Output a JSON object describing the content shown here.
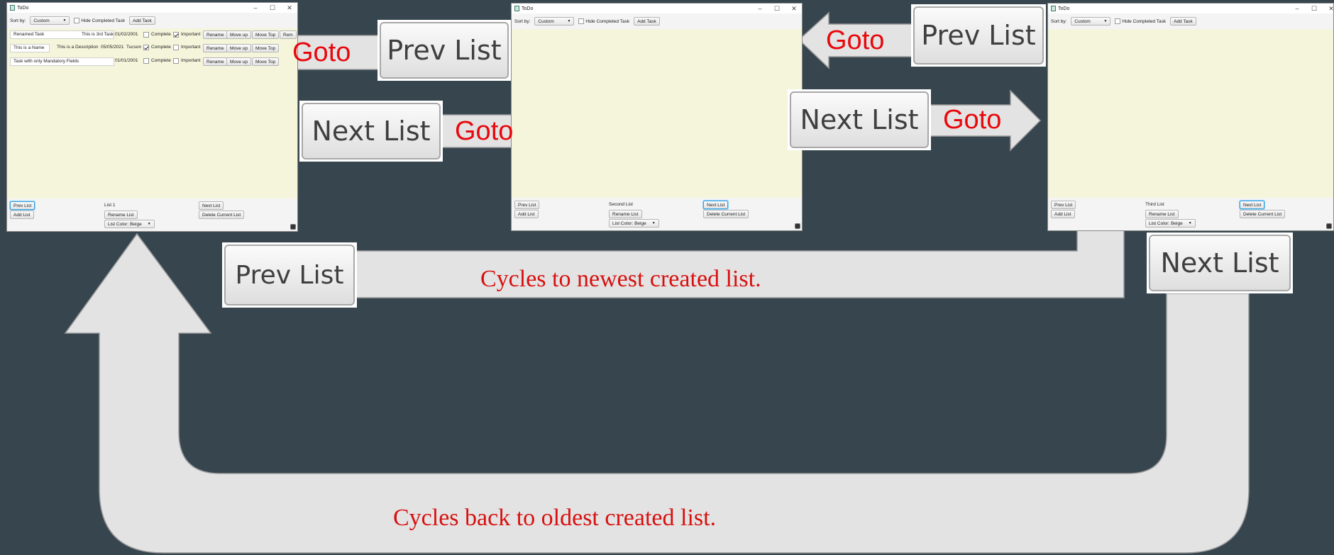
{
  "windows": [
    {
      "title": "ToDo",
      "toolbar": {
        "sort_label": "Sort by:",
        "sort_value": "Custom",
        "hide_label": "Hide Completed Task",
        "add_task": "Add Task"
      },
      "tasks": [
        {
          "name": "Renamed Task",
          "description": "This is 3rd Task",
          "date": "01/02/2001",
          "location": "",
          "complete": false,
          "important": true
        },
        {
          "name": "This is a Name",
          "description": "This is a Description",
          "date": "05/05/2021",
          "location": "Tucson",
          "complete": true,
          "important": false
        },
        {
          "name": "Task with only Mandatory Fields",
          "description": "",
          "date": "01/01/2001",
          "location": "",
          "complete": false,
          "important": false
        }
      ],
      "task_labels": {
        "complete": "Complete",
        "important": "Important",
        "rename": "Rename",
        "move_up": "Move up",
        "move_top": "Move Top",
        "remove": "Rem"
      },
      "bottom": {
        "prev_list": "Prev List",
        "add_list": "Add List",
        "list_name": "List 1",
        "rename_list": "Rename List",
        "list_color": "List Color: Beige",
        "next_list": "Next List",
        "delete_list": "Delete Current List"
      }
    },
    {
      "title": "ToDo",
      "toolbar": {
        "sort_label": "Sort by:",
        "sort_value": "Custom",
        "hide_label": "Hide Completed Task",
        "add_task": "Add Task"
      },
      "tasks": [],
      "bottom": {
        "prev_list": "Prev List",
        "add_list": "Add List",
        "list_name": "Second List",
        "rename_list": "Rename List",
        "list_color": "List Color: Beige",
        "next_list": "Next List",
        "delete_list": "Delete Current List"
      }
    },
    {
      "title": "ToDo",
      "toolbar": {
        "sort_label": "Sort by:",
        "sort_value": "Custom",
        "hide_label": "Hide Completed Task",
        "add_task": "Add Task"
      },
      "tasks": [],
      "bottom": {
        "prev_list": "Prev List",
        "add_list": "Add List",
        "list_name": "Third List",
        "rename_list": "Rename List",
        "list_color": "List Color: Beige",
        "next_list": "Next List",
        "delete_list": "Delete Current List"
      }
    }
  ],
  "callouts": {
    "prev_list": "Prev List",
    "next_list": "Next List",
    "goto": "Goto"
  },
  "captions": {
    "newest": "Cycles to newest created list.",
    "oldest": "Cycles back to oldest created list."
  },
  "colors": {
    "background": "#36454e",
    "list_beige": "#f5f5dc",
    "annotation_red": "#e8080c",
    "arrow_fill": "#e3e3e3"
  }
}
